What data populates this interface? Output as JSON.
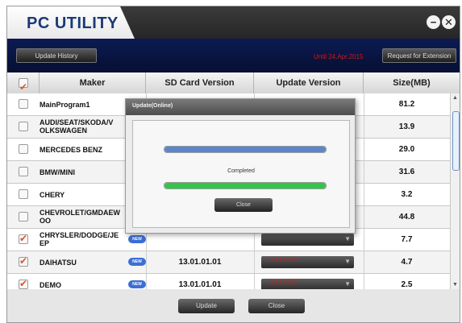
{
  "window": {
    "title": "PC UTILITY",
    "minimize_glyph": "−",
    "close_glyph": "✕"
  },
  "toolbar": {
    "update_history_label": "Update History",
    "until_text": "Until 24.Apr.2015",
    "request_extension_label": "Request for Extension"
  },
  "table": {
    "columns": [
      "Maker",
      "SD Card Version",
      "Update Version",
      "Size(MB)"
    ],
    "header_checked": true,
    "rows": [
      {
        "maker": "MainProgram1",
        "checked": false,
        "new": false,
        "sd": "",
        "update": "",
        "size": "81.2"
      },
      {
        "maker": "AUDI/SEAT/SKODA/V OLKSWAGEN",
        "checked": false,
        "new": false,
        "sd": "",
        "update": "",
        "size": "13.9"
      },
      {
        "maker": "MERCEDES BENZ",
        "checked": false,
        "new": false,
        "sd": "",
        "update": "",
        "size": "29.0"
      },
      {
        "maker": "BMW/MINI",
        "checked": false,
        "new": false,
        "sd": "",
        "update": "",
        "size": "31.6"
      },
      {
        "maker": "CHERY",
        "checked": false,
        "new": false,
        "sd": "",
        "update": "",
        "size": "3.2"
      },
      {
        "maker": "CHEVROLET/GMDAEW OO",
        "checked": false,
        "new": false,
        "sd": "",
        "update": "",
        "size": "44.8"
      },
      {
        "maker": "CHRYSLER/DODGE/JE EP",
        "checked": true,
        "new": true,
        "sd": "",
        "update": "",
        "size": "7.7"
      },
      {
        "maker": "DAIHATSU",
        "checked": true,
        "new": true,
        "sd": "13.01.01.01",
        "update": "13.01.01.01",
        "size": "4.7"
      },
      {
        "maker": "DEMO",
        "checked": true,
        "new": true,
        "sd": "13.01.01.01",
        "update": "13.01.01.01",
        "size": "2.5"
      }
    ],
    "new_badge_label": "NEW"
  },
  "dialog": {
    "title": "Update(Online)",
    "status": "Completed",
    "close_label": "Close",
    "progress_top_fraction": 1.0,
    "progress_bottom_fraction": 1.0,
    "colors": {
      "top_bar": "#5b86c9",
      "bottom_bar": "#33c44a"
    }
  },
  "footer": {
    "update_label": "Update",
    "close_label": "Close"
  }
}
